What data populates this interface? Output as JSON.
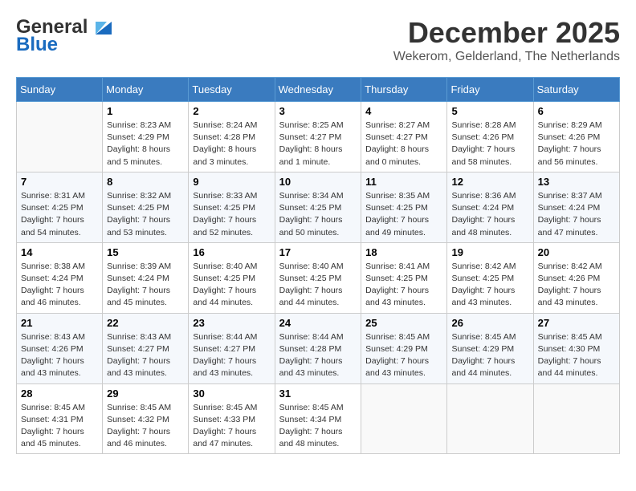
{
  "header": {
    "logo_line1": "General",
    "logo_line2": "Blue",
    "month": "December 2025",
    "location": "Wekerom, Gelderland, The Netherlands"
  },
  "days_of_week": [
    "Sunday",
    "Monday",
    "Tuesday",
    "Wednesday",
    "Thursday",
    "Friday",
    "Saturday"
  ],
  "weeks": [
    [
      {
        "day": "",
        "info": ""
      },
      {
        "day": "1",
        "info": "Sunrise: 8:23 AM\nSunset: 4:29 PM\nDaylight: 8 hours\nand 5 minutes."
      },
      {
        "day": "2",
        "info": "Sunrise: 8:24 AM\nSunset: 4:28 PM\nDaylight: 8 hours\nand 3 minutes."
      },
      {
        "day": "3",
        "info": "Sunrise: 8:25 AM\nSunset: 4:27 PM\nDaylight: 8 hours\nand 1 minute."
      },
      {
        "day": "4",
        "info": "Sunrise: 8:27 AM\nSunset: 4:27 PM\nDaylight: 8 hours\nand 0 minutes."
      },
      {
        "day": "5",
        "info": "Sunrise: 8:28 AM\nSunset: 4:26 PM\nDaylight: 7 hours\nand 58 minutes."
      },
      {
        "day": "6",
        "info": "Sunrise: 8:29 AM\nSunset: 4:26 PM\nDaylight: 7 hours\nand 56 minutes."
      }
    ],
    [
      {
        "day": "7",
        "info": "Sunrise: 8:31 AM\nSunset: 4:25 PM\nDaylight: 7 hours\nand 54 minutes."
      },
      {
        "day": "8",
        "info": "Sunrise: 8:32 AM\nSunset: 4:25 PM\nDaylight: 7 hours\nand 53 minutes."
      },
      {
        "day": "9",
        "info": "Sunrise: 8:33 AM\nSunset: 4:25 PM\nDaylight: 7 hours\nand 52 minutes."
      },
      {
        "day": "10",
        "info": "Sunrise: 8:34 AM\nSunset: 4:25 PM\nDaylight: 7 hours\nand 50 minutes."
      },
      {
        "day": "11",
        "info": "Sunrise: 8:35 AM\nSunset: 4:25 PM\nDaylight: 7 hours\nand 49 minutes."
      },
      {
        "day": "12",
        "info": "Sunrise: 8:36 AM\nSunset: 4:24 PM\nDaylight: 7 hours\nand 48 minutes."
      },
      {
        "day": "13",
        "info": "Sunrise: 8:37 AM\nSunset: 4:24 PM\nDaylight: 7 hours\nand 47 minutes."
      }
    ],
    [
      {
        "day": "14",
        "info": "Sunrise: 8:38 AM\nSunset: 4:24 PM\nDaylight: 7 hours\nand 46 minutes."
      },
      {
        "day": "15",
        "info": "Sunrise: 8:39 AM\nSunset: 4:24 PM\nDaylight: 7 hours\nand 45 minutes."
      },
      {
        "day": "16",
        "info": "Sunrise: 8:40 AM\nSunset: 4:25 PM\nDaylight: 7 hours\nand 44 minutes."
      },
      {
        "day": "17",
        "info": "Sunrise: 8:40 AM\nSunset: 4:25 PM\nDaylight: 7 hours\nand 44 minutes."
      },
      {
        "day": "18",
        "info": "Sunrise: 8:41 AM\nSunset: 4:25 PM\nDaylight: 7 hours\nand 43 minutes."
      },
      {
        "day": "19",
        "info": "Sunrise: 8:42 AM\nSunset: 4:25 PM\nDaylight: 7 hours\nand 43 minutes."
      },
      {
        "day": "20",
        "info": "Sunrise: 8:42 AM\nSunset: 4:26 PM\nDaylight: 7 hours\nand 43 minutes."
      }
    ],
    [
      {
        "day": "21",
        "info": "Sunrise: 8:43 AM\nSunset: 4:26 PM\nDaylight: 7 hours\nand 43 minutes."
      },
      {
        "day": "22",
        "info": "Sunrise: 8:43 AM\nSunset: 4:27 PM\nDaylight: 7 hours\nand 43 minutes."
      },
      {
        "day": "23",
        "info": "Sunrise: 8:44 AM\nSunset: 4:27 PM\nDaylight: 7 hours\nand 43 minutes."
      },
      {
        "day": "24",
        "info": "Sunrise: 8:44 AM\nSunset: 4:28 PM\nDaylight: 7 hours\nand 43 minutes."
      },
      {
        "day": "25",
        "info": "Sunrise: 8:45 AM\nSunset: 4:29 PM\nDaylight: 7 hours\nand 43 minutes."
      },
      {
        "day": "26",
        "info": "Sunrise: 8:45 AM\nSunset: 4:29 PM\nDaylight: 7 hours\nand 44 minutes."
      },
      {
        "day": "27",
        "info": "Sunrise: 8:45 AM\nSunset: 4:30 PM\nDaylight: 7 hours\nand 44 minutes."
      }
    ],
    [
      {
        "day": "28",
        "info": "Sunrise: 8:45 AM\nSunset: 4:31 PM\nDaylight: 7 hours\nand 45 minutes."
      },
      {
        "day": "29",
        "info": "Sunrise: 8:45 AM\nSunset: 4:32 PM\nDaylight: 7 hours\nand 46 minutes."
      },
      {
        "day": "30",
        "info": "Sunrise: 8:45 AM\nSunset: 4:33 PM\nDaylight: 7 hours\nand 47 minutes."
      },
      {
        "day": "31",
        "info": "Sunrise: 8:45 AM\nSunset: 4:34 PM\nDaylight: 7 hours\nand 48 minutes."
      },
      {
        "day": "",
        "info": ""
      },
      {
        "day": "",
        "info": ""
      },
      {
        "day": "",
        "info": ""
      }
    ]
  ]
}
